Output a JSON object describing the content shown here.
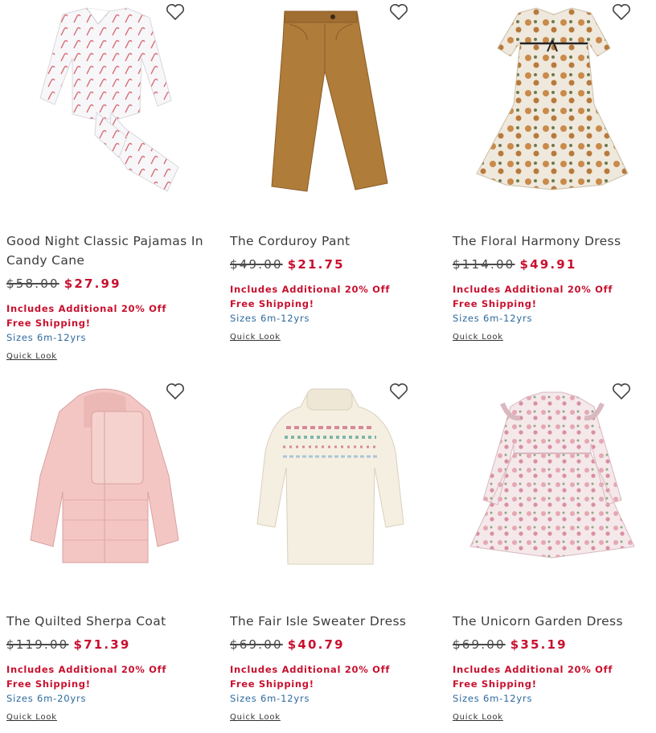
{
  "products": [
    {
      "title": "Good Night Classic Pajamas In Candy Cane",
      "original_price": "$58.00",
      "sale_price": "$27.99",
      "promo": "Includes Additional 20% Off",
      "shipping": "Free Shipping!",
      "sizes": "Sizes 6m-12yrs",
      "quick_look": "Quick Look"
    },
    {
      "title": "The Corduroy Pant",
      "original_price": "$49.00",
      "sale_price": "$21.75",
      "promo": "Includes Additional 20% Off",
      "shipping": "Free Shipping!",
      "sizes": "Sizes 6m-12yrs",
      "quick_look": "Quick Look"
    },
    {
      "title": "The Floral Harmony Dress",
      "original_price": "$114.00",
      "sale_price": "$49.91",
      "promo": "Includes Additional 20% Off",
      "shipping": "Free Shipping!",
      "sizes": "Sizes 6m-12yrs",
      "quick_look": "Quick Look"
    },
    {
      "title": "The Quilted Sherpa Coat",
      "original_price": "$119.00",
      "sale_price": "$71.39",
      "promo": "Includes Additional 20% Off",
      "shipping": "Free Shipping!",
      "sizes": "Sizes 6m-20yrs",
      "quick_look": "Quick Look"
    },
    {
      "title": "The Fair Isle Sweater Dress",
      "original_price": "$69.00",
      "sale_price": "$40.79",
      "promo": "Includes Additional 20% Off",
      "shipping": "Free Shipping!",
      "sizes": "Sizes 6m-12yrs",
      "quick_look": "Quick Look"
    },
    {
      "title": "The Unicorn Garden Dress",
      "original_price": "$69.00",
      "sale_price": "$35.19",
      "promo": "Includes Additional 20% Off",
      "shipping": "Free Shipping!",
      "sizes": "Sizes 6m-12yrs",
      "quick_look": "Quick Look"
    }
  ],
  "icons": {
    "wishlist": "heart-outline-icon"
  },
  "colors": {
    "sale": "#c8102e",
    "sizes": "#2d6a9e",
    "text": "#3c3c3c"
  }
}
